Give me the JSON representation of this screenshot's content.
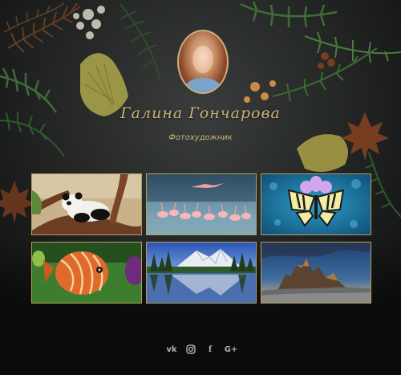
{
  "profile": {
    "name": "Галина Гончарова",
    "role": "Фотохудожник"
  },
  "gallery": [
    {
      "subject": "panda"
    },
    {
      "subject": "flamingos"
    },
    {
      "subject": "butterfly"
    },
    {
      "subject": "fish"
    },
    {
      "subject": "mountain-lake"
    },
    {
      "subject": "rock-peaks"
    }
  ],
  "social": {
    "vk": "vk",
    "facebook": "f",
    "google_plus": "G+"
  },
  "colors": {
    "accent_gold": "#c9b27a",
    "background": "#0b0b0b",
    "icon_gray": "#aeb1b3"
  }
}
